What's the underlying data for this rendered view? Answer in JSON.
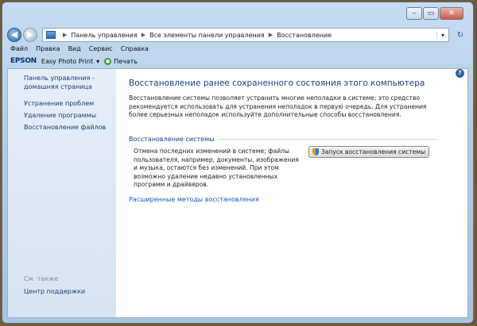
{
  "titlebar": {
    "minimize": "–",
    "maximize": "▭",
    "close": "✕"
  },
  "addressbar": {
    "back": "◀",
    "forward": "▶",
    "crumbs": [
      "Панель управления",
      "Все элементы панели управления",
      "Восстановление"
    ],
    "dropdown": "▾",
    "refresh": "↻"
  },
  "menu": [
    "Файл",
    "Правка",
    "Вид",
    "Сервис",
    "Справка"
  ],
  "epson": {
    "logo": "EPSON",
    "app": "Easy Photo Print",
    "dropdown": "▾",
    "print": "Печать"
  },
  "sidebar": {
    "home_line1": "Панель управления -",
    "home_line2": "домашняя страница",
    "links": [
      "Устранение проблем",
      "Удаление программы",
      "Восстановление файлов"
    ],
    "see_also": "См. также",
    "support": "Центр поддержки"
  },
  "main": {
    "help": "?",
    "heading": "Восстановление ранее сохраненного состояния этого компьютера",
    "description": "Восстановление системы позволяет устранить многие неполадки в системе; это средство рекомендуется использовать для устранения неполадок в первую очередь. Для устранения более серьезных неполадок используйте дополнительные способы восстановления.",
    "section_title": "Восстановление системы",
    "section_text": "Отмена последних изменений в системе; файлы пользователя, например, документы, изображения и музыка, остаются без изменений. При этом возможно удаление недавно установленных программ и драйверов.",
    "restore_button": "Запуск восстановления системы",
    "advanced_link": "Расширенные методы восстановления"
  }
}
